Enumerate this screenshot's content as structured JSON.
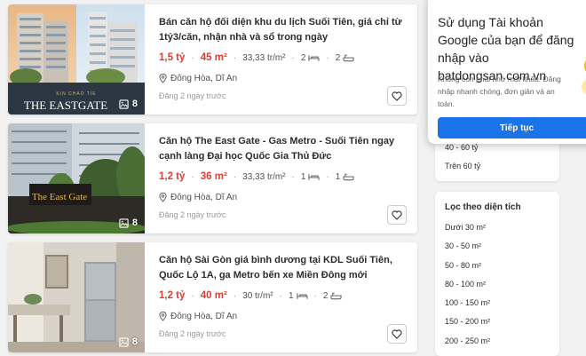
{
  "listings": [
    {
      "title": "Bán căn hộ đối diện khu du lịch Suối Tiên, giá chỉ từ 1tỷ3/căn, nhận nhà và sổ trong ngày",
      "price": "1,5 tỷ",
      "area": "45 m²",
      "price_per_m2": "33,33 tr/m²",
      "bedrooms": "2",
      "bathrooms": "2",
      "location": "Đông Hòa, Dĩ An",
      "posted": "Đăng 2 ngày trước",
      "photo_count": "8",
      "image_text": "THE EASTGATE",
      "image_subtext": "KIN CHAO TIE"
    },
    {
      "title": "Căn hộ The East Gate - Gas Metro - Suối Tiên ngay cạnh làng Đại học Quốc Gia Thủ Đức",
      "price": "1,2 tỷ",
      "area": "36 m²",
      "price_per_m2": "33,33 tr/m²",
      "bedrooms": "1",
      "bathrooms": "1",
      "location": "Đông Hòa, Dĩ An",
      "posted": "Đăng 2 ngày trước",
      "photo_count": "8",
      "image_text": "The East Gate"
    },
    {
      "title": "Căn hộ Sài Gòn giá bình dương tại KDL Suối Tiên, Quốc Lộ 1A, ga Metro bến xe Miền Đông mới",
      "price": "1,2 tỷ",
      "area": "40 m²",
      "price_per_m2": "30 tr/m²",
      "bedrooms": "1",
      "bathrooms": "2",
      "location": "Đông Hòa, Dĩ An",
      "posted": "Đăng 2 ngày trước",
      "photo_count": "8"
    }
  ],
  "sidebar": {
    "price_filter_items": [
      "40 - 60 tỷ",
      "Trên 60 tỷ"
    ],
    "area_filter_title": "Lọc theo diện tích",
    "area_filter_items": [
      "Dưới 30 m²",
      "30 - 50 m²",
      "50 - 80 m²",
      "80 - 100 m²",
      "100 - 150 m²",
      "150 - 200 m²",
      "200 - 250 m²"
    ]
  },
  "google_popup": {
    "title": "Sử dụng Tài khoản Google của bạn để đăng nhập vào batdongsan.com.vn",
    "subtitle": "Không còn phải nhớ mật khẩu. Đăng nhập nhanh chóng, đơn giản và an toàn.",
    "button": "Tiếp tục"
  },
  "colors": {
    "price": "#e03c31",
    "google_blue": "#1a73e8",
    "background": "#f2f2f2"
  }
}
